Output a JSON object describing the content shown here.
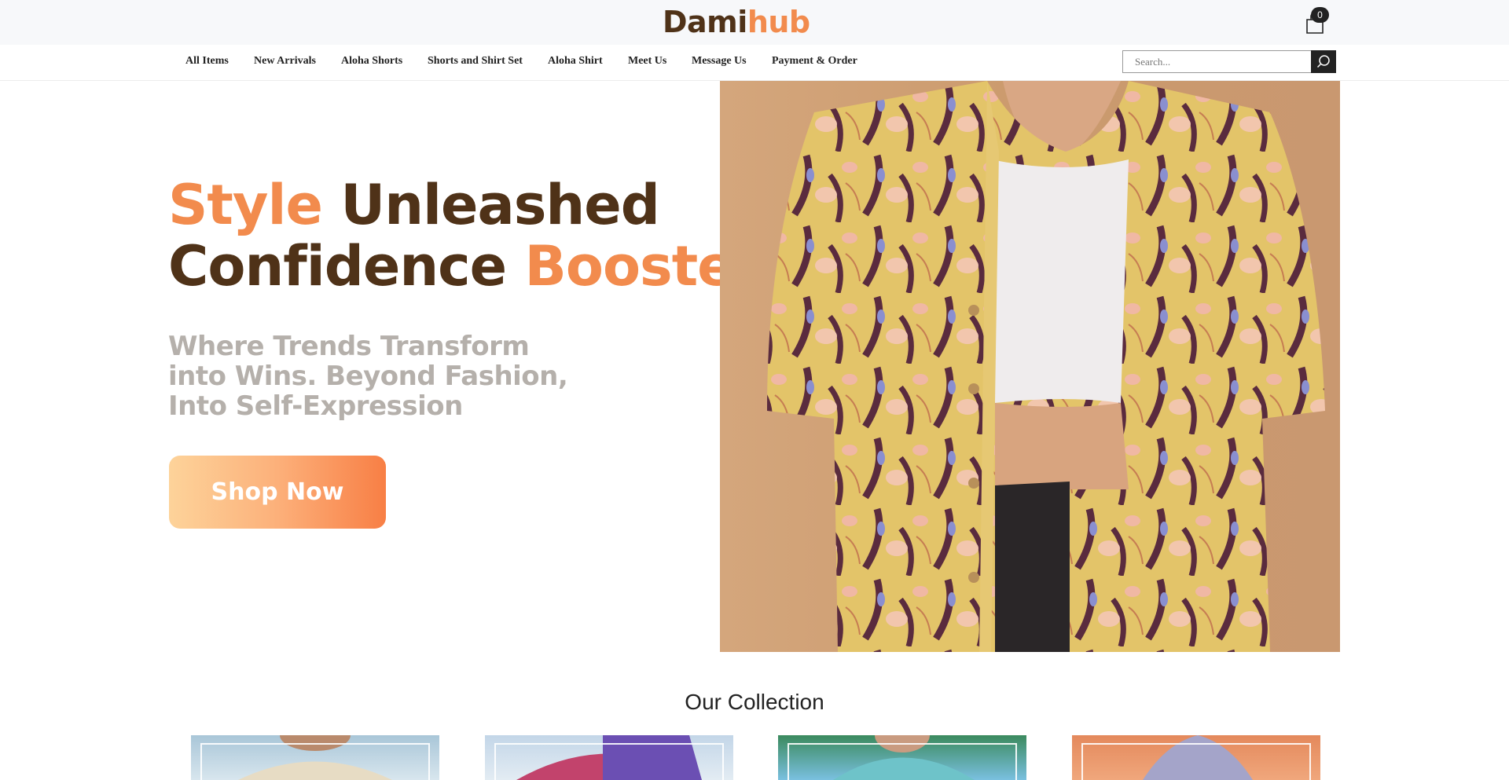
{
  "header": {
    "logo_part1": "Dami",
    "logo_part2": "hub",
    "cart_count": "0",
    "colors": {
      "brand_brown": "#4f3218",
      "brand_orange": "#f28b4d"
    }
  },
  "nav": {
    "items": [
      {
        "label": "All Items"
      },
      {
        "label": "New Arrivals"
      },
      {
        "label": "Aloha Shorts"
      },
      {
        "label": "Shorts and Shirt Set"
      },
      {
        "label": "Aloha Shirt"
      },
      {
        "label": "Meet Us"
      },
      {
        "label": "Message Us"
      },
      {
        "label": "Payment & Order"
      }
    ],
    "search": {
      "placeholder": "Search...",
      "icon": "search-icon"
    }
  },
  "hero": {
    "title_word1": "Style",
    "title_word2": "Unleashed",
    "title_word3": "Confidence",
    "title_word4": "Boosted",
    "subtitle": "Where Trends Transform into Wins. Beyond Fashion, Into Self-Expression",
    "cta_label": "Shop Now"
  },
  "collection": {
    "title": "Our Collection"
  }
}
